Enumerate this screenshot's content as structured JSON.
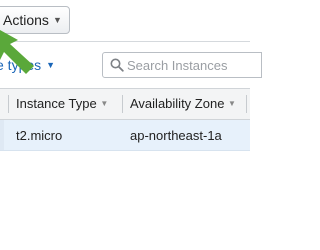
{
  "toolbar": {
    "actions_label": "Actions",
    "actions_caret": "▼"
  },
  "filter": {
    "instance_types_label": "e types",
    "caret": "▼"
  },
  "search": {
    "placeholder": "Search Instances"
  },
  "table": {
    "columns": [
      {
        "label": "Instance Type",
        "caret": "▼"
      },
      {
        "label": "Availability Zone",
        "caret": "▼"
      }
    ],
    "rows": [
      {
        "instance_type": "t2.micro",
        "availability_zone": "ap-northeast-1a"
      }
    ]
  },
  "colors": {
    "accent_link": "#1a66b8",
    "annotation_arrow": "#5aa83a",
    "selected_row": "#e7f1fb"
  }
}
